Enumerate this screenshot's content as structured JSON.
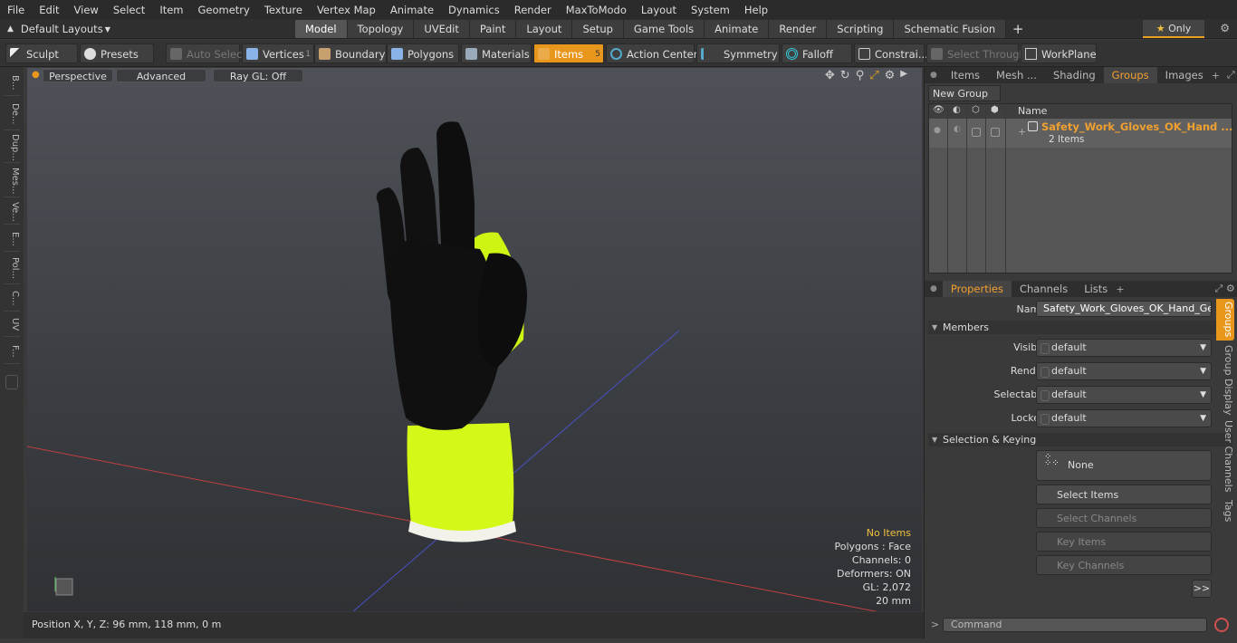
{
  "menu": [
    "File",
    "Edit",
    "View",
    "Select",
    "Item",
    "Geometry",
    "Texture",
    "Vertex Map",
    "Animate",
    "Dynamics",
    "Render",
    "MaxToModo",
    "Layout",
    "System",
    "Help"
  ],
  "layout": {
    "selector": "Default Layouts",
    "only_label": "Only"
  },
  "tabs": [
    "Model",
    "Topology",
    "UVEdit",
    "Paint",
    "Layout",
    "Setup",
    "Game Tools",
    "Animate",
    "Render",
    "Scripting",
    "Schematic Fusion"
  ],
  "toolbar": {
    "sculpt": "Sculpt",
    "presets": "Presets",
    "auto_select": "Auto Select",
    "vertices": "Vertices",
    "vertices_count": "1",
    "boundary": "Boundary",
    "polygons": "Polygons",
    "materials": "Materials",
    "items": "Items",
    "items_count": "5",
    "action_center": "Action Center",
    "symmetry": "Symmetry",
    "falloff": "Falloff",
    "constrain": "Constrai...",
    "select_through": "Select Through",
    "workplane": "WorkPlane"
  },
  "left_tabs": [
    "B...",
    "De...",
    "Dup...",
    "Mes...",
    "Ve...",
    "E...",
    "Pol...",
    "C...",
    "UV",
    "F..."
  ],
  "viewport": {
    "perspective": "Perspective",
    "advanced": "Advanced",
    "raygl": "Ray GL: Off",
    "stats": {
      "items": "No Items",
      "polygons": "Polygons : Face",
      "channels": "Channels: 0",
      "deformers": "Deformers: ON",
      "gl": "GL: 2,072",
      "scale": "20 mm"
    }
  },
  "status": {
    "position": "Position X, Y, Z:  96 mm, 118 mm, 0 m"
  },
  "groups_panel": {
    "tabs": [
      "Items",
      "Mesh ...",
      "Shading",
      "Groups",
      "Images"
    ],
    "new_group": "New Group",
    "name_header": "Name",
    "group_name": "Safety_Work_Gloves_OK_Hand ...",
    "group_items": "2 Items"
  },
  "properties": {
    "tabs": [
      "Properties",
      "Channels",
      "Lists"
    ],
    "name_label": "Name",
    "name_value": "Safety_Work_Gloves_OK_Hand_Gest",
    "members": "Members",
    "rows": [
      {
        "label": "Visible",
        "value": "default"
      },
      {
        "label": "Render",
        "value": "default"
      },
      {
        "label": "Selectable",
        "value": "default"
      },
      {
        "label": "Locked",
        "value": "default"
      }
    ],
    "selection_keying": "Selection & Keying",
    "none": "None",
    "select_items": "Select Items",
    "select_channels": "Select Channels",
    "key_items": "Key Items",
    "key_channels": "Key Channels",
    "more": ">>",
    "side_tabs": [
      "Groups",
      "Group Display",
      "User Channels",
      "Tags"
    ]
  },
  "command": {
    "placeholder": "Command"
  },
  "colors": {
    "accent": "#e8961c",
    "glove_yellow": "#d8ff10",
    "glove_black": "#111111"
  }
}
